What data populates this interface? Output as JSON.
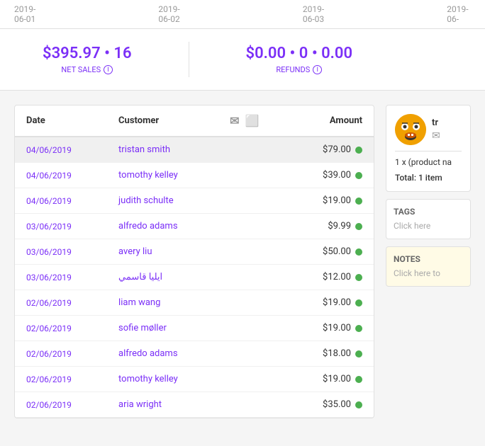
{
  "dates_bar": {
    "dates": [
      "2019-06-01",
      "2019-06-02",
      "2019-06-03",
      "2019-06-"
    ]
  },
  "summary": {
    "net_sales_amount": "$395.97 • 16",
    "net_sales_label": "NET SALES",
    "refunds_amount": "$0.00 • 0 • 0.00",
    "refunds_label": "REFUNDS",
    "info_icon": "ℹ"
  },
  "table": {
    "headers": {
      "date": "Date",
      "customer": "Customer",
      "amount": "Amount"
    },
    "rows": [
      {
        "date": "04/06/2019",
        "customer": "tristan smith",
        "amount": "$79.00",
        "selected": true
      },
      {
        "date": "04/06/2019",
        "customer": "tomothy kelley",
        "amount": "$39.00",
        "selected": false
      },
      {
        "date": "04/06/2019",
        "customer": "judith schulte",
        "amount": "$19.00",
        "selected": false
      },
      {
        "date": "03/06/2019",
        "customer": "alfredo adams",
        "amount": "$9.99",
        "selected": false
      },
      {
        "date": "03/06/2019",
        "customer": "avery liu",
        "amount": "$50.00",
        "selected": false
      },
      {
        "date": "03/06/2019",
        "customer": "ايليا قاسمي",
        "amount": "$12.00",
        "selected": false
      },
      {
        "date": "02/06/2019",
        "customer": "liam wang",
        "amount": "$19.00",
        "selected": false
      },
      {
        "date": "02/06/2019",
        "customer": "sofie møller",
        "amount": "$19.00",
        "selected": false
      },
      {
        "date": "02/06/2019",
        "customer": "alfredo adams",
        "amount": "$18.00",
        "selected": false
      },
      {
        "date": "02/06/2019",
        "customer": "tomothy kelley",
        "amount": "$19.00",
        "selected": false
      },
      {
        "date": "02/06/2019",
        "customer": "aria wright",
        "amount": "$35.00",
        "selected": false
      }
    ]
  },
  "customer_panel": {
    "name": "tr",
    "email_icon": "✉",
    "order_summary": "1 x (product na",
    "order_total": "Total: 1 item"
  },
  "tags": {
    "title": "TAGS",
    "click_text": "Click here"
  },
  "notes": {
    "title": "NOTES",
    "click_text": "Click here to"
  }
}
